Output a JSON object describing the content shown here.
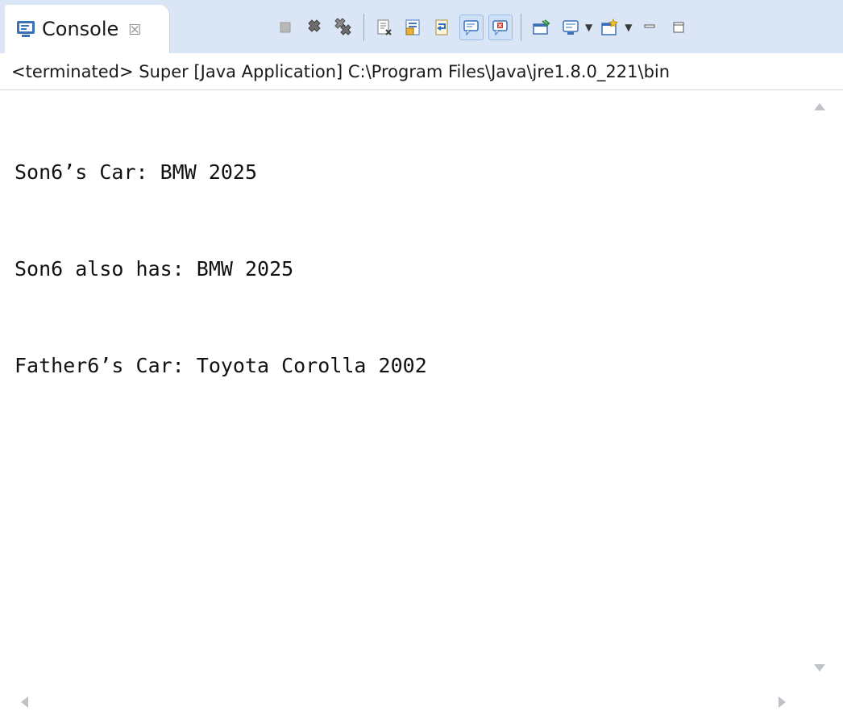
{
  "tab": {
    "label": "Console",
    "icon": "console-icon",
    "close_glyph": "☒"
  },
  "toolbar": {
    "buttons": [
      {
        "icon": "terminate-icon"
      },
      {
        "icon": "remove-launch-icon"
      },
      {
        "icon": "remove-all-terminated-icon"
      },
      {
        "icon": "clear-console-icon"
      },
      {
        "icon": "scroll-lock-icon"
      },
      {
        "icon": "word-wrap-icon"
      },
      {
        "icon": "show-on-stdout-icon",
        "pressed": true
      },
      {
        "icon": "show-on-stderr-icon",
        "pressed": true
      },
      {
        "icon": "pin-console-icon"
      },
      {
        "icon": "display-selected-console-icon"
      },
      {
        "icon": "open-console-icon"
      },
      {
        "icon": "minimize-icon"
      },
      {
        "icon": "maximize-icon"
      }
    ]
  },
  "description": "<terminated> Super [Java Application] C:\\Program Files\\Java\\jre1.8.0_221\\bin",
  "output": {
    "lines": [
      "Son6’s Car: BMW 2025",
      "Son6 also has: BMW 2025",
      "Father6’s Car: Toyota Corolla 2002"
    ]
  },
  "colors": {
    "tab_bar_bg": "#dae6f5",
    "toolbar_pressed_bg": "#cfe1f6",
    "text": "#111111"
  }
}
